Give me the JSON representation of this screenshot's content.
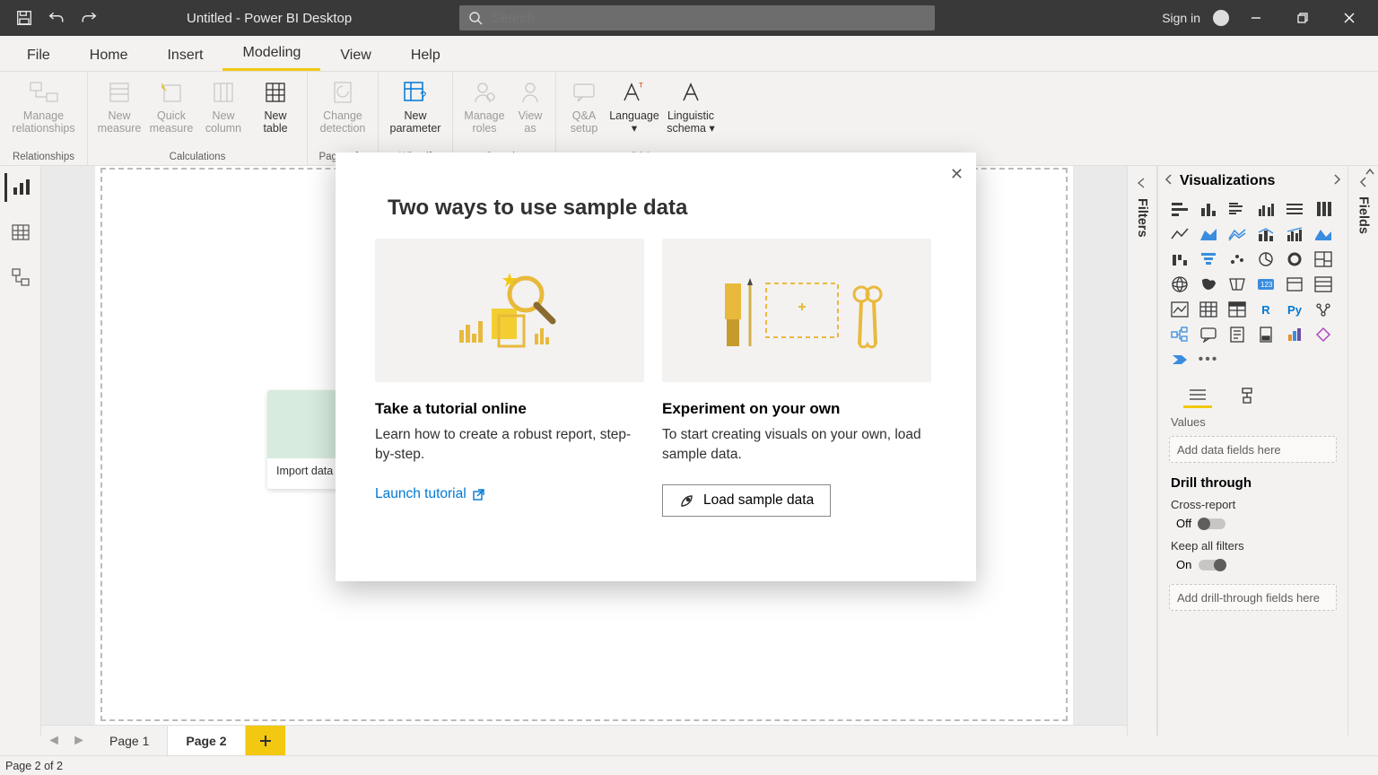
{
  "title": "Untitled - Power BI Desktop",
  "search": {
    "placeholder": "Search"
  },
  "signin": "Sign in",
  "tabs": [
    "File",
    "Home",
    "Insert",
    "Modeling",
    "View",
    "Help"
  ],
  "activeTab": "Modeling",
  "ribbon": {
    "groups": [
      {
        "label": "Relationships",
        "cmds": [
          {
            "l1": "Manage",
            "l2": "relationships"
          }
        ]
      },
      {
        "label": "Calculations",
        "cmds": [
          {
            "l1": "New",
            "l2": "measure"
          },
          {
            "l1": "Quick",
            "l2": "measure"
          },
          {
            "l1": "New",
            "l2": "column"
          },
          {
            "l1": "New",
            "l2": "table",
            "en": true
          }
        ]
      },
      {
        "label": "Page ref...",
        "cmds": [
          {
            "l1": "Change",
            "l2": "detection"
          }
        ]
      },
      {
        "label": "What if",
        "cmds": [
          {
            "l1": "New",
            "l2": "parameter",
            "en": true
          }
        ]
      },
      {
        "label": "Security",
        "cmds": [
          {
            "l1": "Manage",
            "l2": "roles"
          },
          {
            "l1": "View",
            "l2": "as"
          }
        ]
      },
      {
        "label": "Q&A",
        "cmds": [
          {
            "l1": "Q&A",
            "l2": "setup"
          },
          {
            "l1": "Language",
            "l2": " ",
            "en": true,
            "dd": true
          },
          {
            "l1": "Linguistic",
            "l2": "schema",
            "en": true,
            "dd": true
          }
        ]
      }
    ]
  },
  "excelCard": "Import data fr…",
  "pages": {
    "tabs": [
      "Page 1",
      "Page 2"
    ],
    "active": "Page 2"
  },
  "status": "Page 2 of 2",
  "filtersLabel": "Filters",
  "fieldsLabel": "Fields",
  "vis": {
    "title": "Visualizations",
    "values_label": "Values",
    "values_placeholder": "Add data fields here",
    "drill_title": "Drill through",
    "cross": "Cross-report",
    "off": "Off",
    "keep": "Keep all filters",
    "on": "On",
    "drill_placeholder": "Add drill-through fields here"
  },
  "dialog": {
    "title": "Two ways to use sample data",
    "left": {
      "h": "Take a tutorial online",
      "p": "Learn how to create a robust report, step-by-step.",
      "link": "Launch tutorial"
    },
    "right": {
      "h": "Experiment on your own",
      "p": "To start creating visuals on your own, load sample data.",
      "btn": "Load sample data"
    }
  }
}
